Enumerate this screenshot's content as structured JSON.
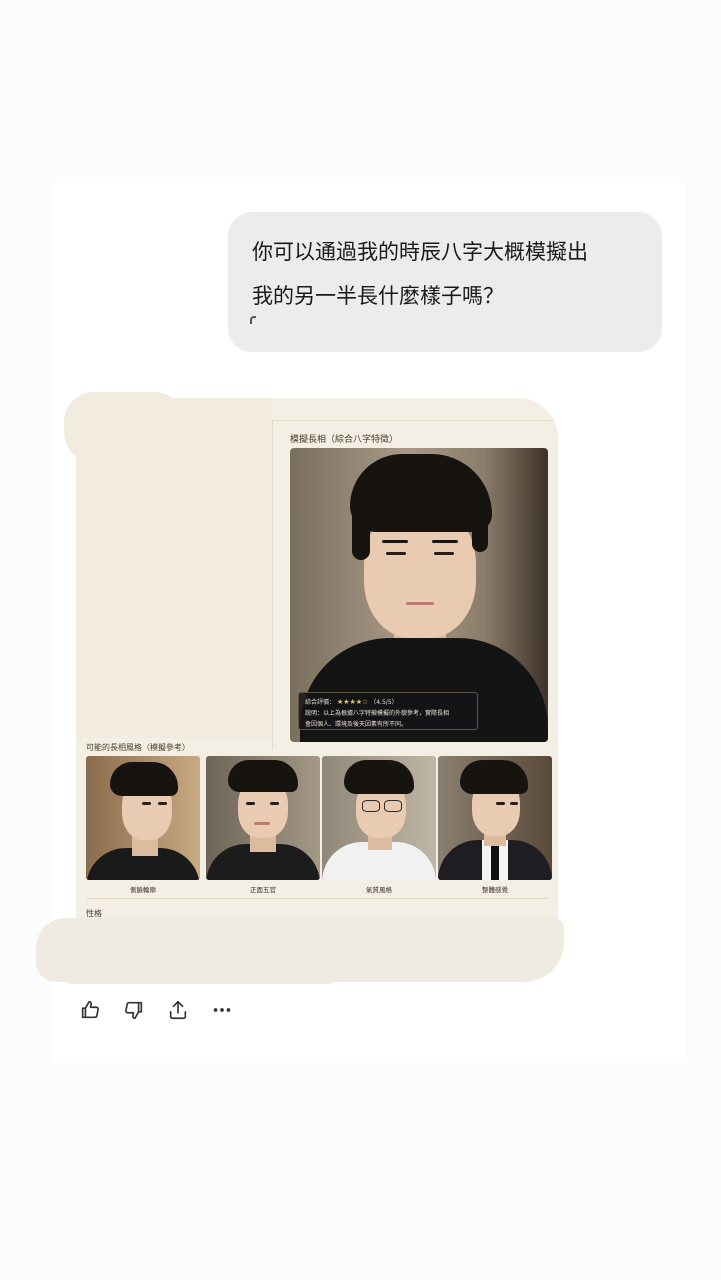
{
  "user_message": {
    "line1": "你可以通過我的時辰八字大概模擬出",
    "line2": "我的另一半長什麼樣子嗎？"
  },
  "result_image": {
    "main_title": "模擬長相（綜合八字特徵）",
    "rating_label": "綜合評價：",
    "rating_stars": "★★★★☆",
    "rating_value": "（4.5/5）",
    "note_line1": "說明：以上為根據八字特徵模擬的外貌參考，實際長相",
    "note_line2": "會因個人、環境及後天因素有所不同。",
    "styles_title": "可能的長相風格（模擬參考）",
    "thumbnails": [
      {
        "caption": "側臉輪廓",
        "shirt_color": "#1a1a1a"
      },
      {
        "caption": "正面五官",
        "shirt_color": "#1c1c1c"
      },
      {
        "caption": "氣質風格",
        "shirt_color": "#f1f1f1"
      },
      {
        "caption": "整體感覺",
        "shirt_color": "#1e1e22"
      }
    ],
    "next_section_label": "性格"
  },
  "actions": {
    "like_icon": "thumbs-up-icon",
    "dislike_icon": "thumbs-down-icon",
    "share_icon": "share-icon",
    "more_icon": "more-icon"
  }
}
